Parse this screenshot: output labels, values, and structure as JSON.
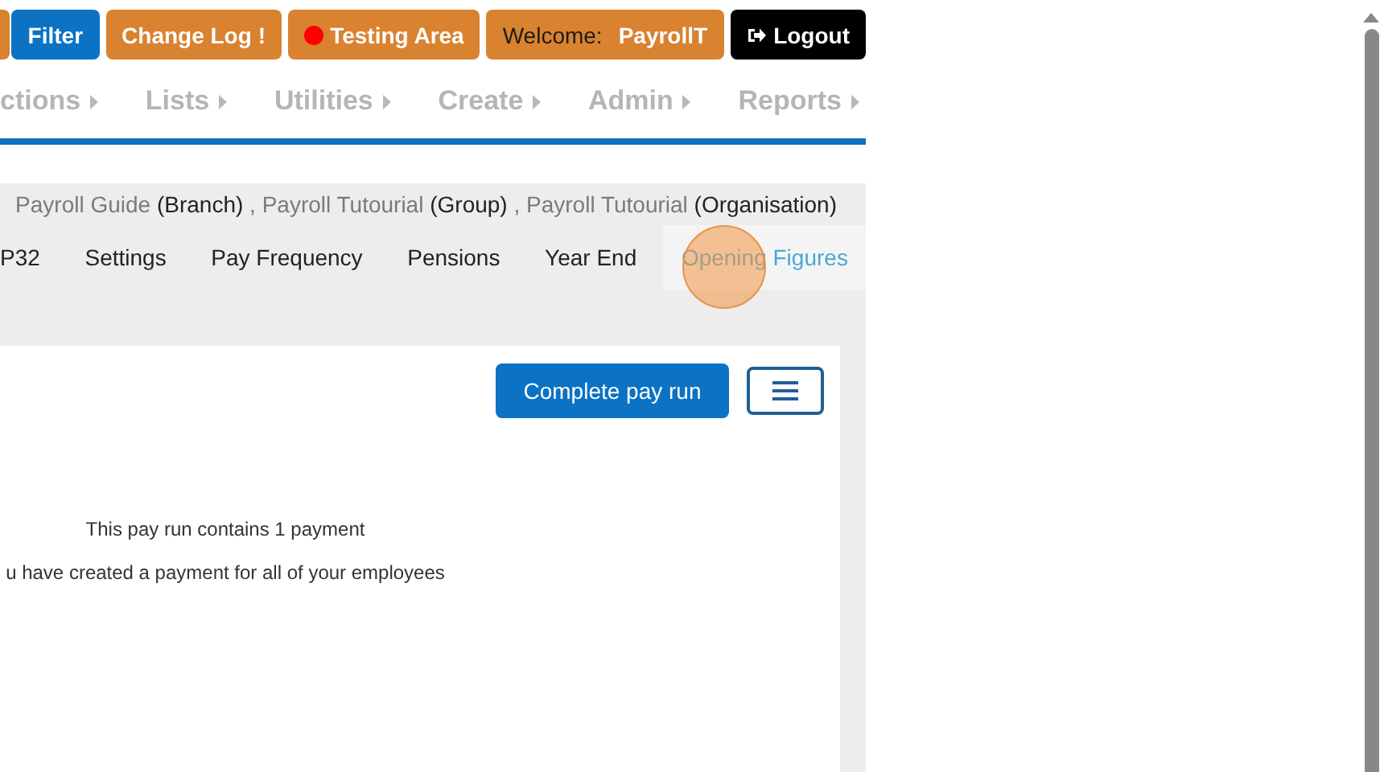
{
  "top_buttons": [
    {
      "kind": "plain",
      "label": "Filter",
      "color": "#0b72c4"
    },
    {
      "kind": "alert",
      "label": "Change Log",
      "badge": "!",
      "color": "#d9822f"
    },
    {
      "kind": "dot",
      "label": "Testing Area",
      "color": "#d9822f"
    },
    {
      "kind": "welcome",
      "label": "Welcome:",
      "user": "PayrollT",
      "color": "#d9822f"
    },
    {
      "kind": "logout",
      "label": "Logout",
      "color": "#000000"
    }
  ],
  "menu": [
    {
      "label": "ctions"
    },
    {
      "label": "Lists"
    },
    {
      "label": "Utilities"
    },
    {
      "label": "Create"
    },
    {
      "label": "Admin"
    },
    {
      "label": "Reports"
    }
  ],
  "breadcrumb_separator": ",",
  "breadcrumb": [
    {
      "name": "Payroll Guide",
      "type": "(Branch)"
    },
    {
      "name": "Payroll Tutourial",
      "type": "(Group)"
    },
    {
      "name": "Payroll Tutourial",
      "type": "(Organisation)"
    }
  ],
  "tabs": [
    {
      "label": "P32",
      "selected": false
    },
    {
      "label": "Settings",
      "selected": false
    },
    {
      "label": "Pay Frequency",
      "selected": false
    },
    {
      "label": "Pensions",
      "selected": false
    },
    {
      "label": "Year End",
      "selected": false
    },
    {
      "label": "Opening Figures",
      "selected": true
    }
  ],
  "card": {
    "primary_button": "Complete pay run",
    "messages": [
      "This pay run contains 1 payment",
      "u have created a payment for all of your employees"
    ]
  }
}
